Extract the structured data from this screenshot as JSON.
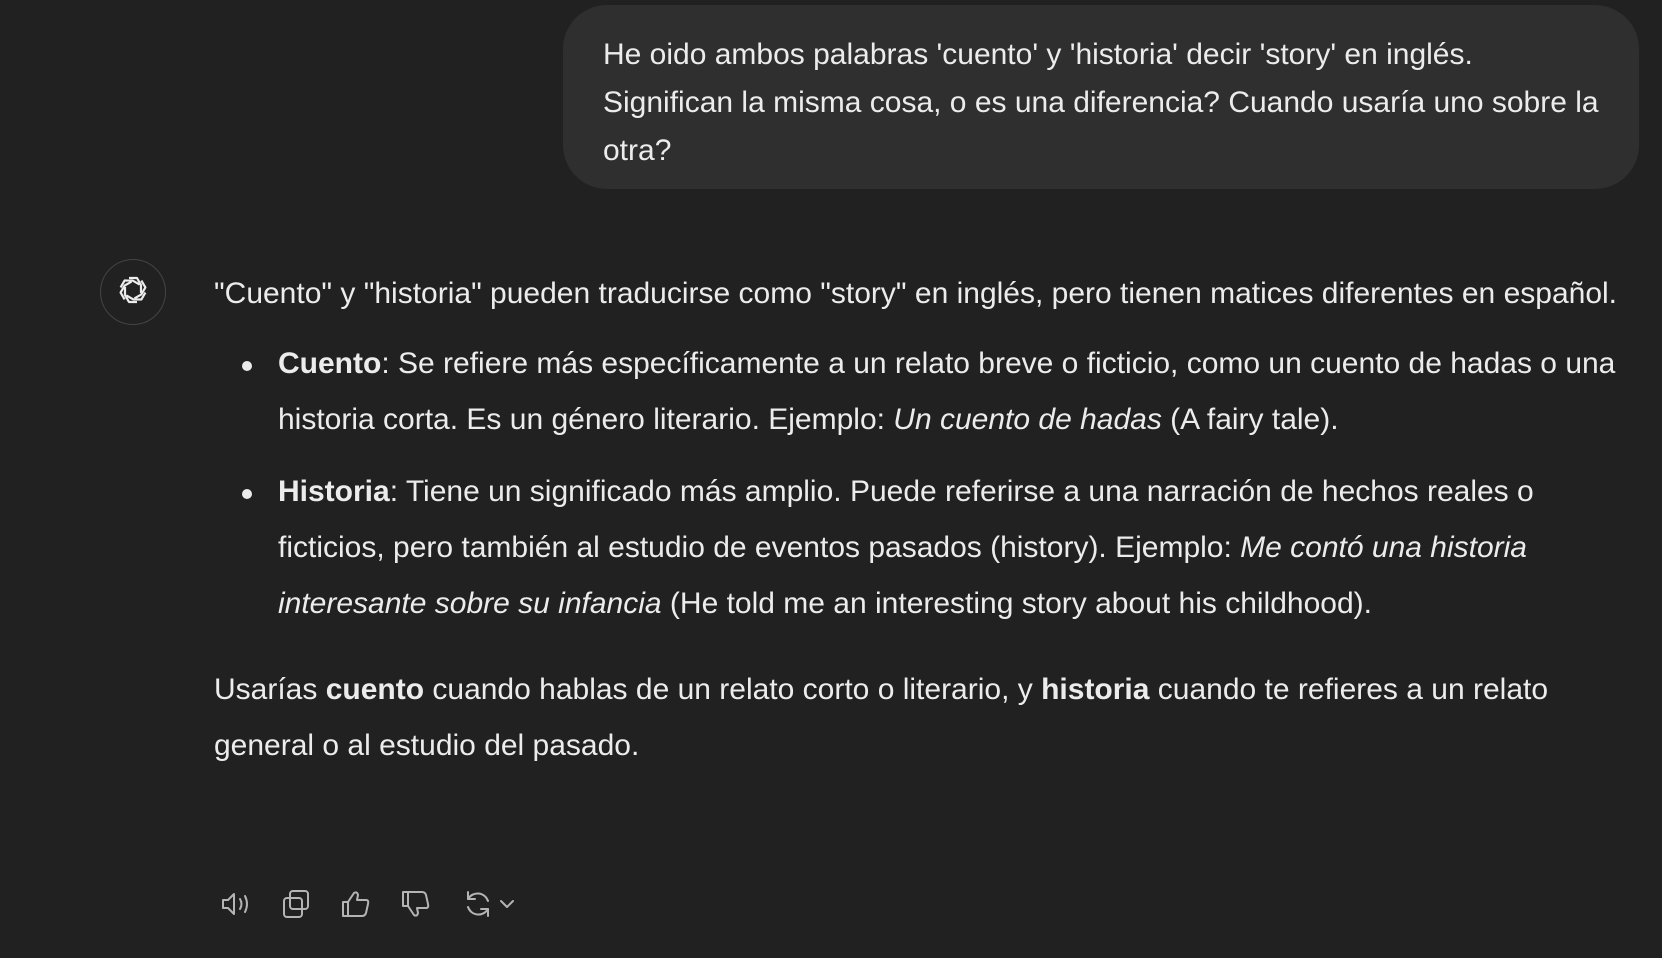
{
  "user_message": {
    "text": "He oido ambos palabras 'cuento' y 'historia' decir 'story' en inglés. Significan la misma cosa, o es una diferencia? Cuando usaría uno sobre la otra?"
  },
  "assistant_message": {
    "intro": "\"Cuento\" y \"historia\" pueden traducirse como \"story\" en inglés, pero tienen matices diferentes en español.",
    "bullets": [
      {
        "term": "Cuento",
        "text": ": Se refiere más específicamente a un relato breve o ficticio, como un cuento de hadas o una historia corta. Es un género literario. Ejemplo: ",
        "example": "Un cuento de hadas",
        "translation": " (A fairy tale)."
      },
      {
        "term": "Historia",
        "text": ": Tiene un significado más amplio. Puede referirse a una narración de hechos reales o ficticios, pero también al estudio de eventos pasados (history). Ejemplo: ",
        "example": "Me contó una historia interesante sobre su infancia",
        "translation": " (He told me an interesting story about his childhood)."
      }
    ],
    "closing": {
      "part1": "Usarías ",
      "bold1": "cuento",
      "part2": " cuando hablas de un relato corto o literario, y ",
      "bold2": "historia",
      "part3": " cuando te refieres a un relato general o al estudio del pasado."
    }
  },
  "actions": [
    {
      "icon": "speaker-icon"
    },
    {
      "icon": "copy-icon"
    },
    {
      "icon": "thumbs-up-icon"
    },
    {
      "icon": "thumbs-down-icon"
    },
    {
      "icon": "regenerate-icon"
    }
  ],
  "colors": {
    "background": "#212121",
    "user_bubble": "#2f2f2f",
    "text": "#ececec",
    "icon": "#b4b4b4"
  }
}
